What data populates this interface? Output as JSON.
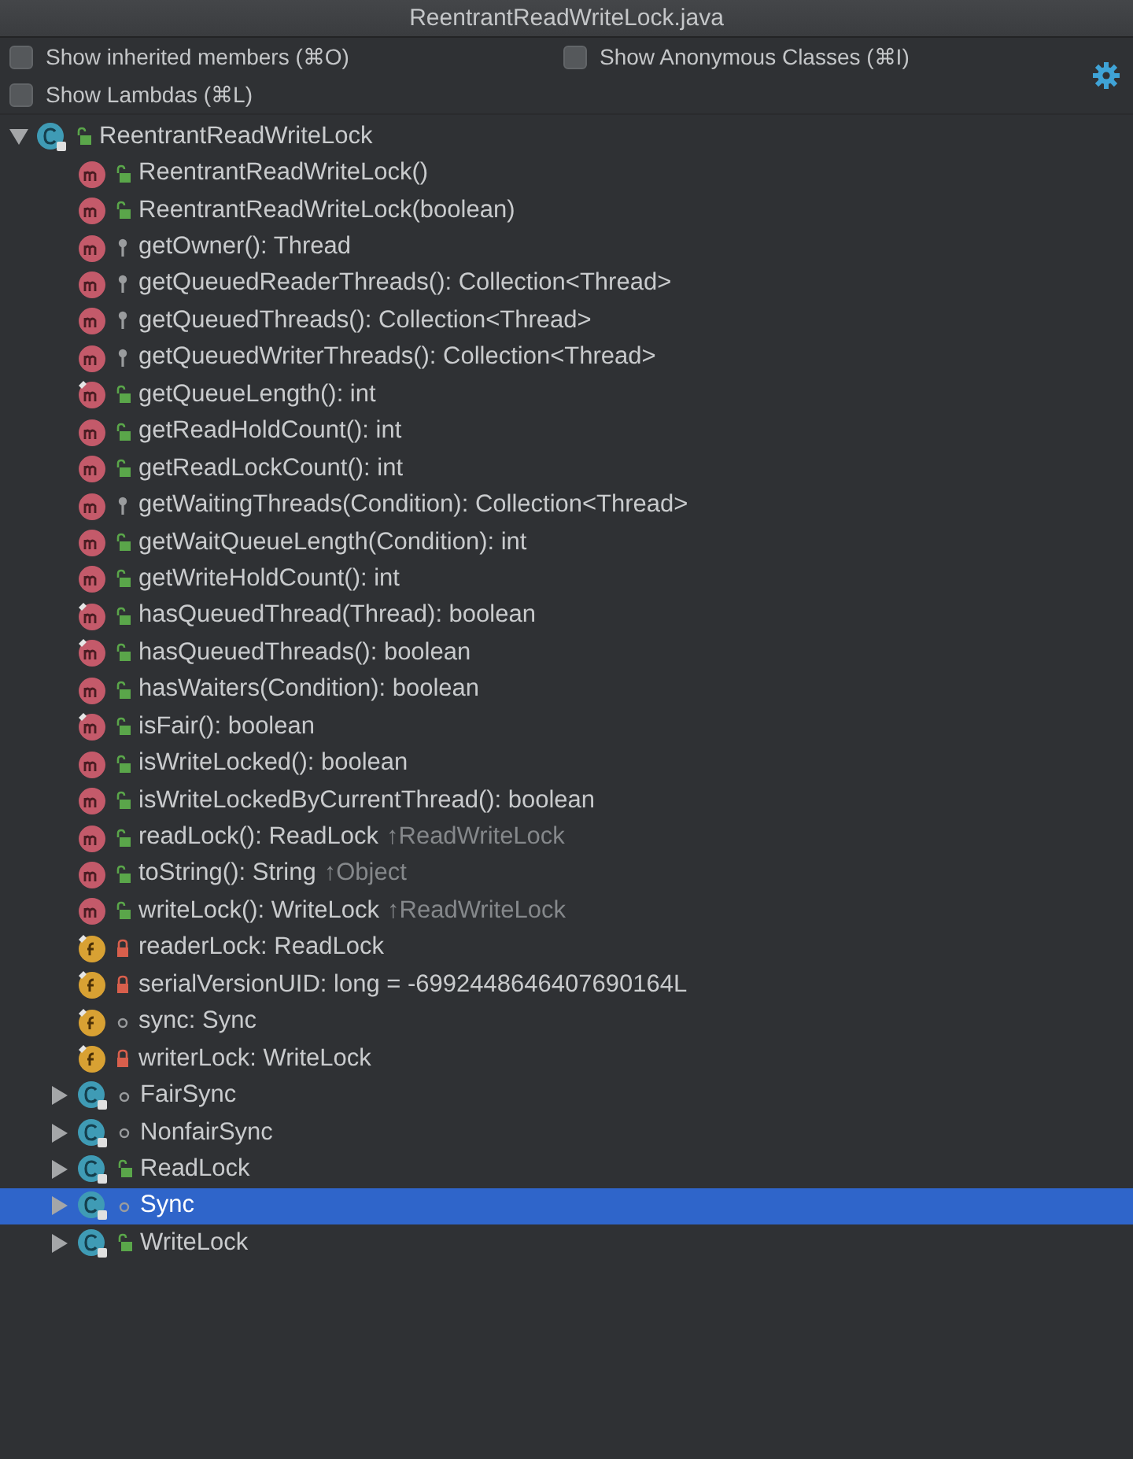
{
  "window": {
    "title": "ReentrantReadWriteLock.java"
  },
  "options": [
    {
      "label": "Show inherited members (⌘O)",
      "checked": false
    },
    {
      "label": "Show Anonymous Classes (⌘I)",
      "checked": false
    },
    {
      "label": "Show Lambdas (⌘L)",
      "checked": false
    }
  ],
  "tree": {
    "label": "ReentrantReadWriteLock",
    "kind": "class",
    "access": {
      "kind": "public"
    },
    "expanded": true,
    "selected": false,
    "children": [
      {
        "kind": "method",
        "access": {
          "kind": "public"
        },
        "label": "ReentrantReadWriteLock()",
        "overrides": false
      },
      {
        "kind": "method",
        "access": {
          "kind": "public"
        },
        "label": "ReentrantReadWriteLock(boolean)",
        "overrides": false
      },
      {
        "kind": "method",
        "access": {
          "kind": "protected"
        },
        "label": "getOwner(): Thread",
        "overrides": false
      },
      {
        "kind": "method",
        "access": {
          "kind": "protected"
        },
        "label": "getQueuedReaderThreads(): Collection<Thread>",
        "overrides": false
      },
      {
        "kind": "method",
        "access": {
          "kind": "protected"
        },
        "label": "getQueuedThreads(): Collection<Thread>",
        "overrides": false
      },
      {
        "kind": "method",
        "access": {
          "kind": "protected"
        },
        "label": "getQueuedWriterThreads(): Collection<Thread>",
        "overrides": false
      },
      {
        "kind": "method",
        "access": {
          "kind": "public"
        },
        "label": "getQueueLength(): int",
        "overrides": true
      },
      {
        "kind": "method",
        "access": {
          "kind": "public"
        },
        "label": "getReadHoldCount(): int",
        "overrides": false
      },
      {
        "kind": "method",
        "access": {
          "kind": "public"
        },
        "label": "getReadLockCount(): int",
        "overrides": false
      },
      {
        "kind": "method",
        "access": {
          "kind": "protected"
        },
        "label": "getWaitingThreads(Condition): Collection<Thread>",
        "overrides": false
      },
      {
        "kind": "method",
        "access": {
          "kind": "public"
        },
        "label": "getWaitQueueLength(Condition): int",
        "overrides": false
      },
      {
        "kind": "method",
        "access": {
          "kind": "public"
        },
        "label": "getWriteHoldCount(): int",
        "overrides": false
      },
      {
        "kind": "method",
        "access": {
          "kind": "public"
        },
        "label": "hasQueuedThread(Thread): boolean",
        "overrides": true
      },
      {
        "kind": "method",
        "access": {
          "kind": "public"
        },
        "label": "hasQueuedThreads(): boolean",
        "overrides": true
      },
      {
        "kind": "method",
        "access": {
          "kind": "public"
        },
        "label": "hasWaiters(Condition): boolean",
        "overrides": false
      },
      {
        "kind": "method",
        "access": {
          "kind": "public"
        },
        "label": "isFair(): boolean",
        "overrides": true
      },
      {
        "kind": "method",
        "access": {
          "kind": "public"
        },
        "label": "isWriteLocked(): boolean",
        "overrides": false
      },
      {
        "kind": "method",
        "access": {
          "kind": "public"
        },
        "label": "isWriteLockedByCurrentThread(): boolean",
        "overrides": false
      },
      {
        "kind": "method",
        "access": {
          "kind": "public"
        },
        "label": "readLock(): ReadLock",
        "inherited_from": "↑ReadWriteLock",
        "overrides": false
      },
      {
        "kind": "method",
        "access": {
          "kind": "public"
        },
        "label": "toString(): String",
        "inherited_from": "↑Object",
        "overrides": false
      },
      {
        "kind": "method",
        "access": {
          "kind": "public"
        },
        "label": "writeLock(): WriteLock",
        "inherited_from": "↑ReadWriteLock",
        "overrides": false
      },
      {
        "kind": "field",
        "access": {
          "kind": "private"
        },
        "label": "readerLock: ReadLock",
        "overrides": true
      },
      {
        "kind": "field",
        "access": {
          "kind": "private"
        },
        "label": "serialVersionUID: long = -6992448646407690164L",
        "overrides": true
      },
      {
        "kind": "field",
        "access": {
          "kind": "package"
        },
        "label": "sync: Sync",
        "overrides": true
      },
      {
        "kind": "field",
        "access": {
          "kind": "private"
        },
        "label": "writerLock: WriteLock",
        "overrides": true
      },
      {
        "kind": "class",
        "access": {
          "kind": "package"
        },
        "label": "FairSync",
        "expanded": false,
        "selected": false
      },
      {
        "kind": "class",
        "access": {
          "kind": "package"
        },
        "label": "NonfairSync",
        "expanded": false,
        "selected": false
      },
      {
        "kind": "class",
        "access": {
          "kind": "public"
        },
        "label": "ReadLock",
        "expanded": false,
        "selected": false
      },
      {
        "kind": "class",
        "access": {
          "kind": "package"
        },
        "label": "Sync",
        "expanded": false,
        "selected": true
      },
      {
        "kind": "class",
        "access": {
          "kind": "public"
        },
        "label": "WriteLock",
        "expanded": false,
        "selected": false
      }
    ]
  }
}
